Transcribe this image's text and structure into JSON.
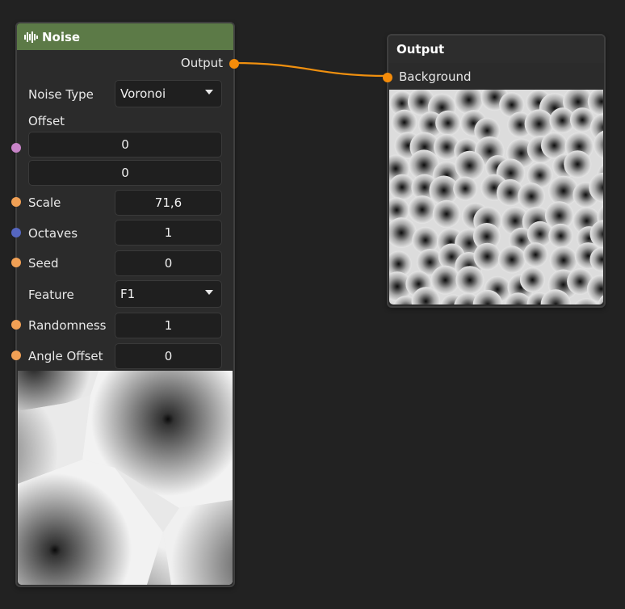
{
  "noise_node": {
    "title": "Noise",
    "output_port_label": "Output",
    "noise_type": {
      "label": "Noise Type",
      "value": "Voronoi"
    },
    "offset": {
      "label": "Offset",
      "x": "0",
      "y": "0"
    },
    "scale": {
      "label": "Scale",
      "value": "71,6"
    },
    "octaves": {
      "label": "Octaves",
      "value": "1"
    },
    "seed": {
      "label": "Seed",
      "value": "0"
    },
    "feature": {
      "label": "Feature",
      "value": "F1"
    },
    "randomness": {
      "label": "Randomness",
      "value": "1"
    },
    "angle_offset": {
      "label": "Angle Offset",
      "value": "0"
    }
  },
  "output_node": {
    "title": "Output",
    "input_port_label": "Background"
  },
  "colors": {
    "noise_header": "#5c7a47",
    "float_port": "#f0a055",
    "vector_port": "#c884c8",
    "int_port": "#5566c0",
    "wire": "#f0900f",
    "output_port": "#f58c0a"
  }
}
